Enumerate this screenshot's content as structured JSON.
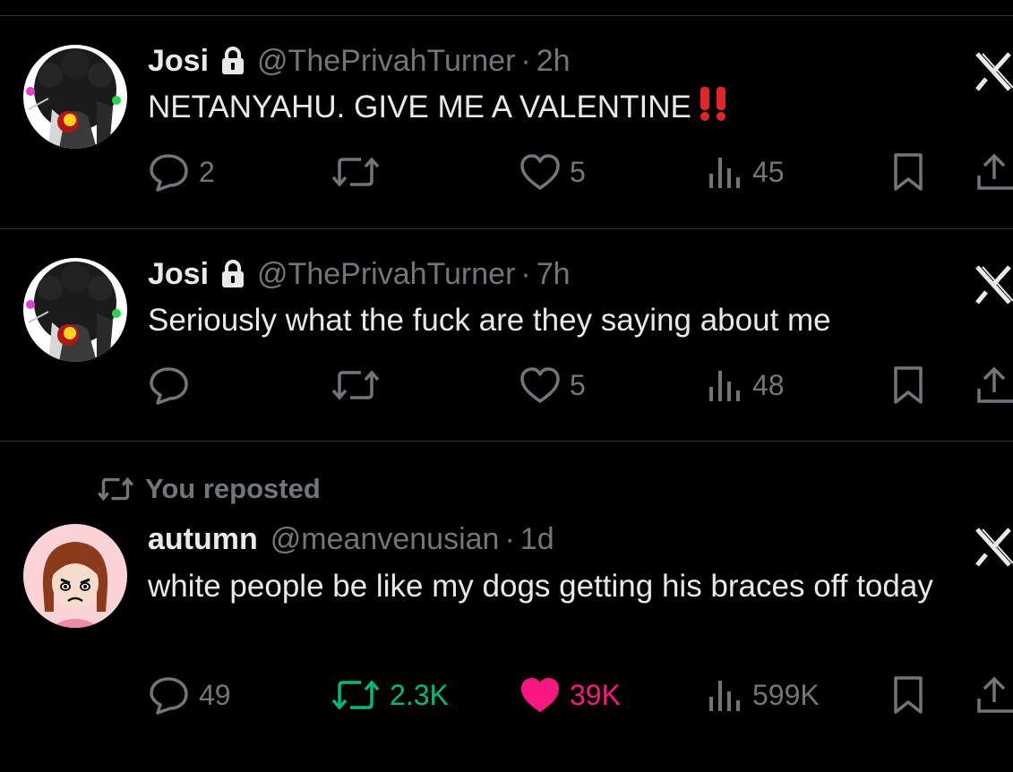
{
  "tweets": [
    {
      "name": "Josi",
      "handle": "@ThePrivahTurner",
      "separator": "·",
      "time": "2h",
      "text": "NETANYAHU. GIVE ME A VALENTINE",
      "text_suffix": "‼️",
      "replies": "2",
      "reposts": "",
      "likes": "5",
      "views": "45",
      "liked": false,
      "reposted": false
    },
    {
      "name": "Josi",
      "handle": "@ThePrivahTurner",
      "separator": "·",
      "time": "7h",
      "text": "Seriously what the fuck are they saying about me",
      "replies": "",
      "reposts": "",
      "likes": "5",
      "views": "48",
      "liked": false,
      "reposted": false
    },
    {
      "context": "You reposted",
      "name": "autumn",
      "handle": "@meanvenusian",
      "separator": "·",
      "time": "1d",
      "text": "white people be like my dogs getting his braces off today",
      "replies": "49",
      "reposts": "2.3K",
      "likes": "39K",
      "views": "599K",
      "liked": true,
      "reposted": true
    }
  ],
  "colors": {
    "background": "#000000",
    "text": "#e7e9ea",
    "muted": "#71767b",
    "divider": "#2f3336",
    "like_active": "#f91880",
    "repost_active": "#00ba7c",
    "emoji_red": "#e0262b"
  },
  "icons": {
    "reply": "reply-icon",
    "repost": "repost-icon",
    "like": "heart-icon",
    "views": "views-icon",
    "bookmark": "bookmark-icon",
    "share": "share-icon",
    "grok": "grok-icon",
    "lock": "lock-icon"
  }
}
